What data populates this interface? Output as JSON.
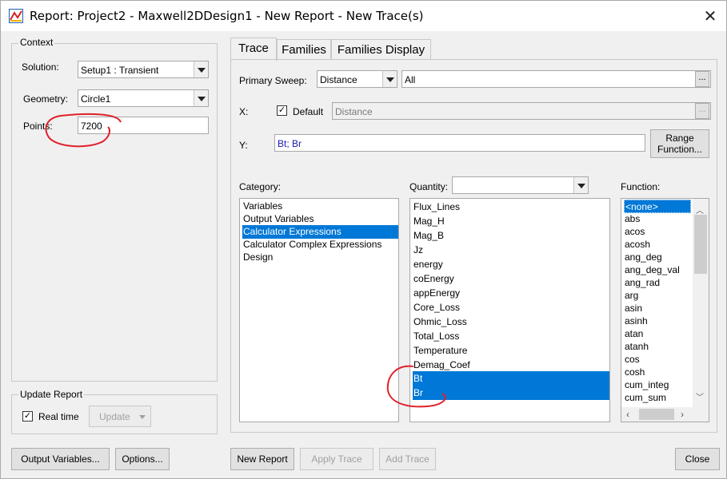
{
  "window": {
    "title": "Report: Project2 - Maxwell2DDesign1 - New Report - New Trace(s)"
  },
  "context": {
    "group_label": "Context",
    "solution_label": "Solution:",
    "solution_value": "Setup1 : Transient",
    "geometry_label": "Geometry:",
    "geometry_value": "Circle1",
    "points_label": "Points:",
    "points_value": "7200"
  },
  "update_report": {
    "group_label": "Update Report",
    "realtime_label": "Real time",
    "realtime_checked": "✓",
    "update_label": "Update"
  },
  "tabs": [
    {
      "label": "Trace"
    },
    {
      "label": "Families"
    },
    {
      "label": "Families Display"
    }
  ],
  "trace": {
    "primary_sweep_label": "Primary Sweep:",
    "primary_sweep_value": "Distance",
    "sweep_range": "All",
    "x_label": "X:",
    "default_label": "Default",
    "default_checked": "✓",
    "x_value": "Distance",
    "y_label": "Y:",
    "y_value": "Bt; Br",
    "range_function_label_1": "Range",
    "range_function_label_2": "Function...",
    "ellipsis": "..."
  },
  "category": {
    "label": "Category:",
    "items": [
      "Variables",
      "Output Variables",
      "Calculator Expressions",
      "Calculator Complex Expressions",
      "Design"
    ],
    "selected_index": 2
  },
  "quantity": {
    "label": "Quantity:",
    "filter_value": "",
    "items": [
      "Flux_Lines",
      "Mag_H",
      "Mag_B",
      "Jz",
      "energy",
      "coEnergy",
      "appEnergy",
      "Core_Loss",
      "Ohmic_Loss",
      "Total_Loss",
      "Temperature",
      "Demag_Coef",
      "Bt",
      "Br"
    ],
    "selected": [
      "Bt",
      "Br"
    ]
  },
  "function": {
    "label": "Function:",
    "items": [
      "<none>",
      "abs",
      "acos",
      "acosh",
      "ang_deg",
      "ang_deg_val",
      "ang_rad",
      "arg",
      "asin",
      "asinh",
      "atan",
      "atanh",
      "cos",
      "cosh",
      "cum_integ",
      "cum_sum"
    ],
    "selected_index": 0
  },
  "buttons": {
    "output_variables": "Output Variables...",
    "options": "Options...",
    "new_report": "New Report",
    "apply_trace": "Apply Trace",
    "add_trace": "Add Trace",
    "close": "Close"
  },
  "colors": {
    "selection": "#0078d7",
    "annotation": "#e0202a"
  }
}
